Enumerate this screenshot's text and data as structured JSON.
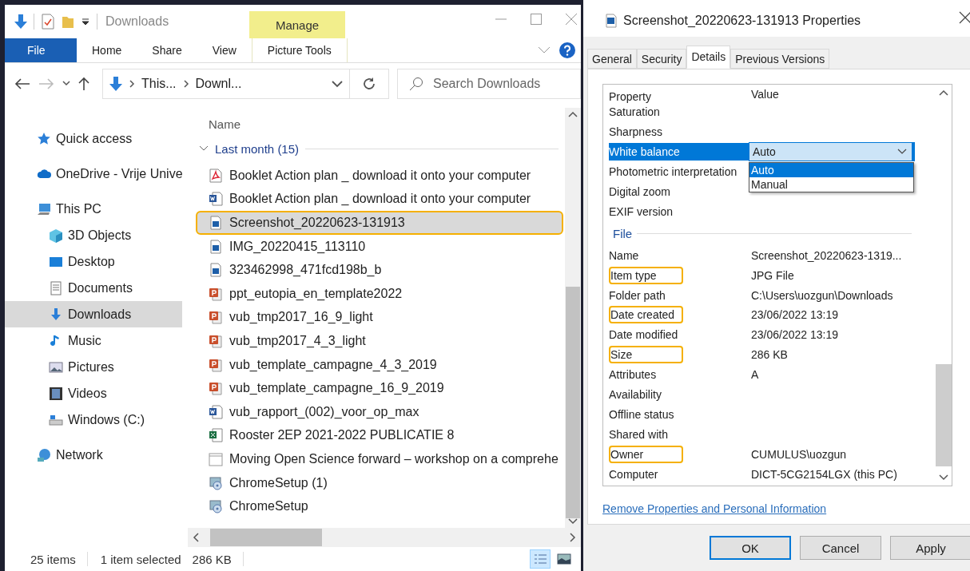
{
  "explorer": {
    "title": "Downloads",
    "ribbon": {
      "contextual_header": "Manage",
      "tabs": [
        {
          "label": "File",
          "kind": "backstage"
        },
        {
          "label": "Home",
          "kind": "tab"
        },
        {
          "label": "Share",
          "kind": "tab"
        },
        {
          "label": "View",
          "kind": "tab"
        },
        {
          "label": "Picture Tools",
          "kind": "contextual"
        }
      ]
    },
    "address": {
      "crumbs": [
        "This...",
        "Downl..."
      ],
      "search_placeholder": "Search Downloads"
    },
    "nav": [
      {
        "label": "Quick access",
        "kind": "star",
        "selected": false
      },
      {
        "label": "OneDrive - Vrije Unive",
        "kind": "cloud",
        "selected": false
      },
      {
        "label": "This PC",
        "kind": "pc",
        "selected": false,
        "children": [
          {
            "label": "3D Objects",
            "kind": "cube",
            "selected": false
          },
          {
            "label": "Desktop",
            "kind": "desktop",
            "selected": false
          },
          {
            "label": "Documents",
            "kind": "document",
            "selected": false
          },
          {
            "label": "Downloads",
            "kind": "download",
            "selected": true
          },
          {
            "label": "Music",
            "kind": "music",
            "selected": false
          },
          {
            "label": "Pictures",
            "kind": "picture",
            "selected": false
          },
          {
            "label": "Videos",
            "kind": "video",
            "selected": false
          },
          {
            "label": "Windows  (C:)",
            "kind": "drive",
            "selected": false
          }
        ]
      },
      {
        "label": "Network",
        "kind": "network",
        "selected": false
      }
    ],
    "list": {
      "column": "Name",
      "group": {
        "label": "Last month (15)",
        "expanded": true
      },
      "files": [
        {
          "name": "Booklet Action plan _ download it onto your computer",
          "kind": "pdf",
          "selected": false,
          "highlighted": false
        },
        {
          "name": "Booklet Action plan _ download it onto your computer",
          "kind": "word",
          "selected": false,
          "highlighted": false
        },
        {
          "name": "Screenshot_20220623-131913",
          "kind": "image",
          "selected": true,
          "highlighted": true
        },
        {
          "name": "IMG_20220415_113110",
          "kind": "image",
          "selected": false,
          "highlighted": false
        },
        {
          "name": "323462998_471fcd198b_b",
          "kind": "image",
          "selected": false,
          "highlighted": false
        },
        {
          "name": "ppt_eutopia_en_template2022",
          "kind": "ppt",
          "selected": false,
          "highlighted": false
        },
        {
          "name": "vub_tmp2017_16_9_light",
          "kind": "ppt",
          "selected": false,
          "highlighted": false
        },
        {
          "name": "vub_tmp2017_4_3_light",
          "kind": "ppt",
          "selected": false,
          "highlighted": false
        },
        {
          "name": "vub_template_campagne_4_3_2019",
          "kind": "ppt",
          "selected": false,
          "highlighted": false
        },
        {
          "name": "vub_template_campagne_16_9_2019",
          "kind": "ppt",
          "selected": false,
          "highlighted": false
        },
        {
          "name": "vub_rapport_(002)_voor_op_max",
          "kind": "word",
          "selected": false,
          "highlighted": false
        },
        {
          "name": "Rooster 2EP 2021-2022 PUBLICATIE 8",
          "kind": "excel",
          "selected": false,
          "highlighted": false
        },
        {
          "name": "Moving Open Science forward – workshop on a comprehe",
          "kind": "calendar",
          "selected": false,
          "highlighted": false
        },
        {
          "name": "ChromeSetup (1)",
          "kind": "setup",
          "selected": false,
          "highlighted": false
        },
        {
          "name": "ChromeSetup",
          "kind": "setup",
          "selected": false,
          "highlighted": false
        }
      ]
    },
    "status": {
      "count": "25 items",
      "selection": "1 item selected",
      "size": "286 KB",
      "views": [
        {
          "kind": "details",
          "selected": true
        },
        {
          "kind": "large_icons",
          "selected": false
        }
      ]
    }
  },
  "properties": {
    "title": "Screenshot_20220623-131913 Properties",
    "tabs": [
      {
        "label": "General",
        "selected": false
      },
      {
        "label": "Security",
        "selected": false
      },
      {
        "label": "Details",
        "selected": true
      },
      {
        "label": "Previous Versions",
        "selected": false
      }
    ],
    "columns": [
      "Property",
      "Value"
    ],
    "rows": [
      {
        "kind": "property",
        "label": "Saturation",
        "highlighted": false
      },
      {
        "kind": "property",
        "label": "Sharpness",
        "highlighted": false
      },
      {
        "kind": "dropdown",
        "label": "White balance",
        "value": "Auto",
        "selected": true,
        "highlighted": false,
        "options": [
          {
            "label": "Auto",
            "selected": true
          },
          {
            "label": "Manual",
            "selected": false
          }
        ]
      },
      {
        "kind": "property",
        "label": "Photometric interpretation",
        "highlighted": false
      },
      {
        "kind": "property",
        "label": "Digital zoom",
        "highlighted": false
      },
      {
        "kind": "property",
        "label": "EXIF version",
        "highlighted": false
      },
      {
        "kind": "section",
        "label": "File"
      },
      {
        "kind": "property",
        "label": "Name",
        "value": "Screenshot_20220623-1319...",
        "highlighted": false
      },
      {
        "kind": "property",
        "label": "Item type",
        "value": "JPG File",
        "highlighted": true
      },
      {
        "kind": "property",
        "label": "Folder path",
        "value": "C:\\Users\\uozgun\\Downloads",
        "highlighted": false
      },
      {
        "kind": "property",
        "label": "Date created",
        "value": "23/06/2022 13:19",
        "highlighted": true
      },
      {
        "kind": "property",
        "label": "Date modified",
        "value": "23/06/2022 13:19",
        "highlighted": false
      },
      {
        "kind": "property",
        "label": "Size",
        "value": "286 KB",
        "highlighted": true
      },
      {
        "kind": "property",
        "label": "Attributes",
        "value": "A",
        "highlighted": false
      },
      {
        "kind": "property",
        "label": "Availability",
        "highlighted": false
      },
      {
        "kind": "property",
        "label": "Offline status",
        "highlighted": false
      },
      {
        "kind": "property",
        "label": "Shared with",
        "highlighted": false
      },
      {
        "kind": "property",
        "label": "Owner",
        "value": "CUMULUS\\uozgun",
        "highlighted": true
      },
      {
        "kind": "property",
        "label": "Computer",
        "value": "DICT-5CG2154LGX (this PC)",
        "highlighted": false
      }
    ],
    "link": "Remove Properties and Personal Information",
    "buttons": [
      {
        "label": "OK",
        "kind": "default"
      },
      {
        "label": "Cancel",
        "kind": "normal"
      },
      {
        "label": "Apply",
        "kind": "normal"
      }
    ]
  }
}
